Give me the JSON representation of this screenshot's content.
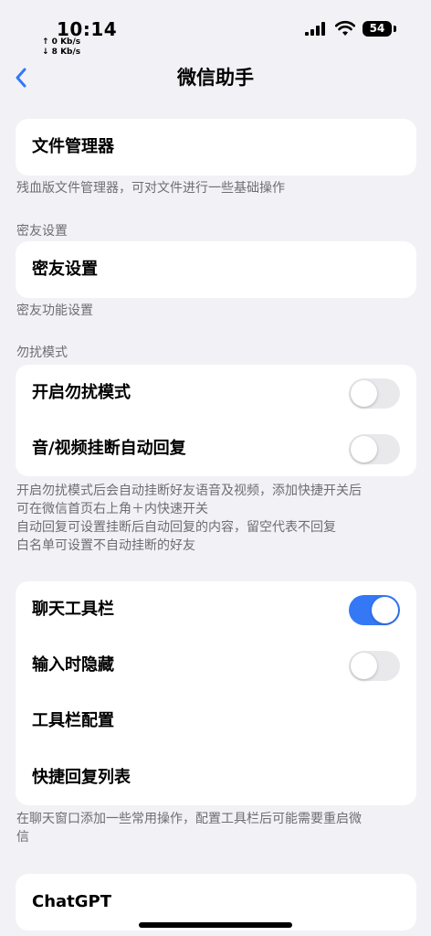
{
  "status_bar": {
    "time": "10:14",
    "upload_speed": "↑ 0 Kb/s",
    "download_speed": "↓ 8 Kb/s",
    "battery": "54"
  },
  "nav": {
    "title": "微信助手",
    "back_icon": "chevron-left-icon"
  },
  "file_section": {
    "item_label": "文件管理器",
    "footer": "残血版文件管理器，可对文件进行一些基础操作"
  },
  "friend_section": {
    "header": "密友设置",
    "item_label": "密友设置",
    "footer": "密友功能设置"
  },
  "dnd_section": {
    "header": "勿扰模式",
    "items": [
      {
        "label": "开启勿扰模式",
        "toggle": false
      },
      {
        "label": "音/视频挂断自动回复",
        "toggle": false
      }
    ],
    "footer": [
      "开启勿扰模式后会自动挂断好友语音及视频，添加快捷开关后",
      "可在微信首页右上角＋内快速开关",
      "自动回复可设置挂断后自动回复的内容，留空代表不回复",
      "白名单可设置不自动挂断的好友"
    ]
  },
  "toolbar_section": {
    "items": [
      {
        "label": "聊天工具栏",
        "toggle": true
      },
      {
        "label": "输入时隐藏",
        "toggle": false
      },
      {
        "label": "工具栏配置"
      },
      {
        "label": "快捷回复列表"
      }
    ],
    "footer": [
      "在聊天窗口添加一些常用操作，配置工具栏后可能需要重启微",
      "信"
    ]
  },
  "chatgpt_section": {
    "item_label": "ChatGPT"
  },
  "colors": {
    "background": "#f2f2f6",
    "accent": "#3478f6",
    "toggle_off": "#e9e9ec",
    "secondary_text": "#6d6d72"
  }
}
